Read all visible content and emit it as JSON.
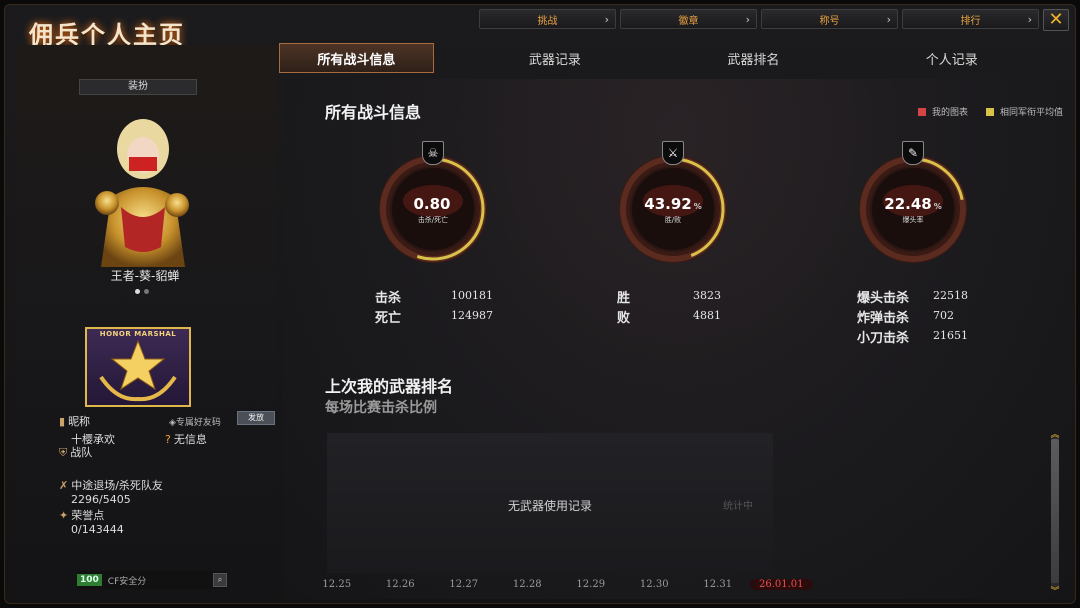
{
  "window": {
    "title": "佣兵个人主页",
    "close_label": "✕"
  },
  "top_nav": [
    {
      "label": "挑战"
    },
    {
      "label": "徽章"
    },
    {
      "label": "称号"
    },
    {
      "label": "排行"
    }
  ],
  "left_panel": {
    "skin_label": "装扮",
    "character_name": "王者-葵-貂蝉",
    "rank_badge_text": "HONOR MARSHAL",
    "nickname_label": "昵称",
    "nickname_value": "十樱承欢",
    "friend_code_label": "专属好友码",
    "send_button": "发放",
    "no_info": "无信息",
    "team_label": "战队",
    "quit_label": "中途退场/杀死队友",
    "quit_value": "2296/5405",
    "honor_label": "荣誉点",
    "honor_value": "0/143444",
    "security_score": "100",
    "security_label": "CF安全分"
  },
  "tabs": [
    {
      "label": "所有战斗信息",
      "active": true
    },
    {
      "label": "武器记录"
    },
    {
      "label": "武器排名"
    },
    {
      "label": "个人记录"
    }
  ],
  "main": {
    "section_title": "所有战斗信息",
    "legend": {
      "mine": "我的图表",
      "avg": "相同军衔平均值",
      "mine_color": "#d64545",
      "avg_color": "#d9c24a"
    },
    "gauges": [
      {
        "value": "0.80",
        "unit": "",
        "label": "击杀/死亡",
        "icon": "skull-icon",
        "glyph": "☠",
        "ring": 0.55
      },
      {
        "value": "43.92",
        "unit": "%",
        "label": "胜/败",
        "icon": "crossed-guns-icon",
        "glyph": "⚔",
        "ring": 0.44
      },
      {
        "value": "22.48",
        "unit": "%",
        "label": "爆头率",
        "icon": "rifle-icon",
        "glyph": "✎",
        "ring": 0.22
      }
    ],
    "stats_kd": [
      {
        "k": "击杀",
        "v": "100181"
      },
      {
        "k": "死亡",
        "v": "124987"
      }
    ],
    "stats_wl": [
      {
        "k": "胜",
        "v": "3823"
      },
      {
        "k": "败",
        "v": "4881"
      }
    ],
    "stats_hs": [
      {
        "k": "爆头击杀",
        "v": "22518"
      },
      {
        "k": "炸弹击杀",
        "v": "702"
      },
      {
        "k": "小刀击杀",
        "v": "21651"
      }
    ],
    "weapon_title": "上次我的武器排名",
    "weapon_subtitle": "每场比赛击杀比例",
    "no_record": "无武器使用记录",
    "stat_tag": "统计中",
    "dates": [
      "12.25",
      "12.26",
      "12.27",
      "12.28",
      "12.29",
      "12.30",
      "12.31",
      "26.01.01"
    ],
    "selected_date_index": 7
  }
}
